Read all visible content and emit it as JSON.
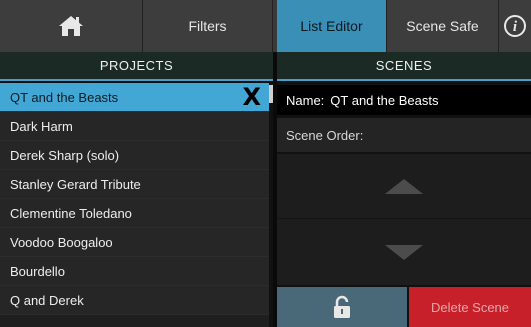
{
  "toolbar": {
    "home_icon": "home-icon",
    "filters_label": "Filters",
    "list_editor_label": "List Editor",
    "scene_safe_label": "Scene Safe",
    "info_icon": "info-icon"
  },
  "projects": {
    "header": "PROJECTS",
    "items": [
      {
        "label": "QT and the Beasts",
        "selected": true
      },
      {
        "label": "Dark Harm"
      },
      {
        "label": "Derek Sharp (solo)"
      },
      {
        "label": "Stanley Gerard Tribute"
      },
      {
        "label": "Clementine Toledano"
      },
      {
        "label": "Voodoo Boogaloo"
      },
      {
        "label": "Bourdello"
      },
      {
        "label": "Q and Derek"
      }
    ],
    "delete_icon": "X"
  },
  "scenes": {
    "header": "SCENES",
    "name_prefix": "Name:",
    "name_value": "QT and the Beasts",
    "scene_order_label": "Scene Order:",
    "delete_label": "Delete Scene"
  },
  "colors": {
    "accent": "#43a7d6",
    "active_tab": "#3a8fb6",
    "delete": "#c8202a",
    "lock": "#4a6978"
  }
}
